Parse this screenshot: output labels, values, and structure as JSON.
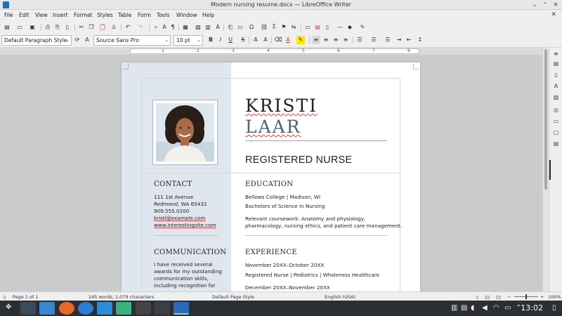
{
  "window": {
    "title": "Modern nursing resume.docx — LibreOffice Writer"
  },
  "menu": [
    "File",
    "Edit",
    "View",
    "Insert",
    "Format",
    "Styles",
    "Table",
    "Form",
    "Tools",
    "Window",
    "Help"
  ],
  "format_bar": {
    "paragraph_style": "Default Paragraph Style",
    "font_name": "Source Sans Pro",
    "font_size": "10 pt"
  },
  "ruler": {
    "marks": [
      "1",
      "2",
      "3",
      "4",
      "5",
      "6",
      "7",
      "8"
    ]
  },
  "resume": {
    "first_name": "KRISTI",
    "last_name": "LAAR",
    "role": "REGISTERED NURSE",
    "contact": {
      "heading": "CONTACT",
      "address1": "111 1st Avenue",
      "address2": "Redmond, WA 65432",
      "phone": "909.555.0100",
      "email": "kristi@example.com",
      "website": "www.interestingsite.com"
    },
    "communication": {
      "heading": "COMMUNICATION",
      "lines": [
        "I have received several",
        "awards for my outstanding",
        "communication skills,",
        "including recognition for"
      ]
    },
    "education": {
      "heading": "EDUCATION",
      "school": "Bellows College | Madison, WI",
      "degree": "Bachelors of Science in Nursing",
      "coursework1": "Relevant coursework: Anatomy and physiology,",
      "coursework2": "pharmacology, nursing ethics, and patient care management."
    },
    "experience": {
      "heading": "EXPERIENCE",
      "date1": "November 20XX–October 20XX",
      "job1": "Registered Nurse | Pediatrics | Wholeness Healthcare",
      "date2": "December 20XX–November 20XX"
    }
  },
  "status": {
    "page": "Page 1 of 1",
    "words": "145 words, 1,079 characters",
    "page_style": "Default Page Style",
    "language": "English (USA)",
    "zoom": "100%"
  },
  "taskbar": {
    "clock": "13:02"
  },
  "colors": {
    "accent_blue": "#2a6ab4",
    "sidebar_panel": "#dfe6ed",
    "name_blue": "#4d647a"
  }
}
